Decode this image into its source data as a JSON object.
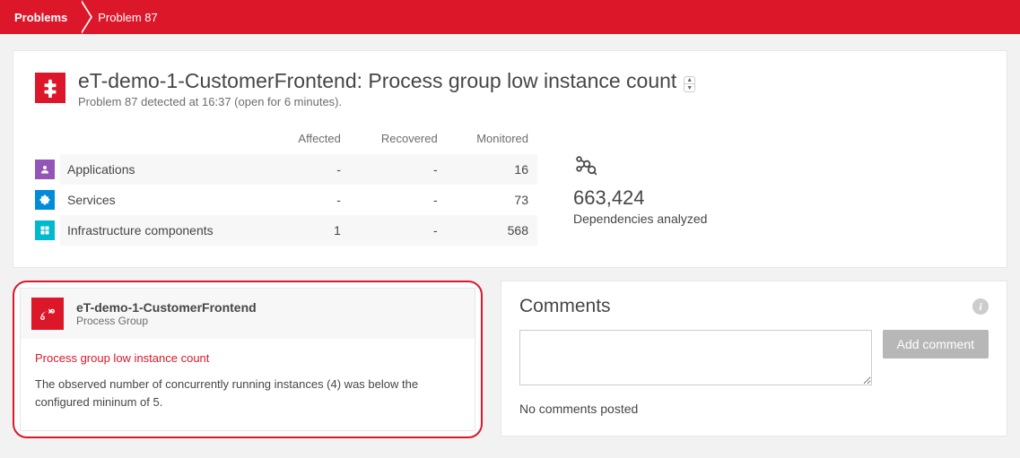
{
  "breadcrumb": {
    "root": "Problems",
    "current": "Problem 87"
  },
  "header": {
    "title": "eT-demo-1-CustomerFrontend: Process group low instance count",
    "subtitle": "Problem 87 detected at 16:37 (open for 6 minutes)."
  },
  "stats": {
    "columns": {
      "label": "",
      "affected": "Affected",
      "recovered": "Recovered",
      "monitored": "Monitored"
    },
    "rows": [
      {
        "label": "Applications",
        "affected": "-",
        "recovered": "-",
        "monitored": "16"
      },
      {
        "label": "Services",
        "affected": "-",
        "recovered": "-",
        "monitored": "73"
      },
      {
        "label": "Infrastructure components",
        "affected": "1",
        "recovered": "-",
        "monitored": "568"
      }
    ]
  },
  "dependencies": {
    "count": "663,424",
    "label": "Dependencies analyzed"
  },
  "problem": {
    "entity": "eT-demo-1-CustomerFrontend",
    "entity_type": "Process Group",
    "event": "Process group low instance count",
    "description": "The observed number of concurrently running instances (4) was below the configured mininum of 5."
  },
  "comments": {
    "title": "Comments",
    "add_label": "Add comment",
    "empty": "No comments posted",
    "placeholder": ""
  }
}
